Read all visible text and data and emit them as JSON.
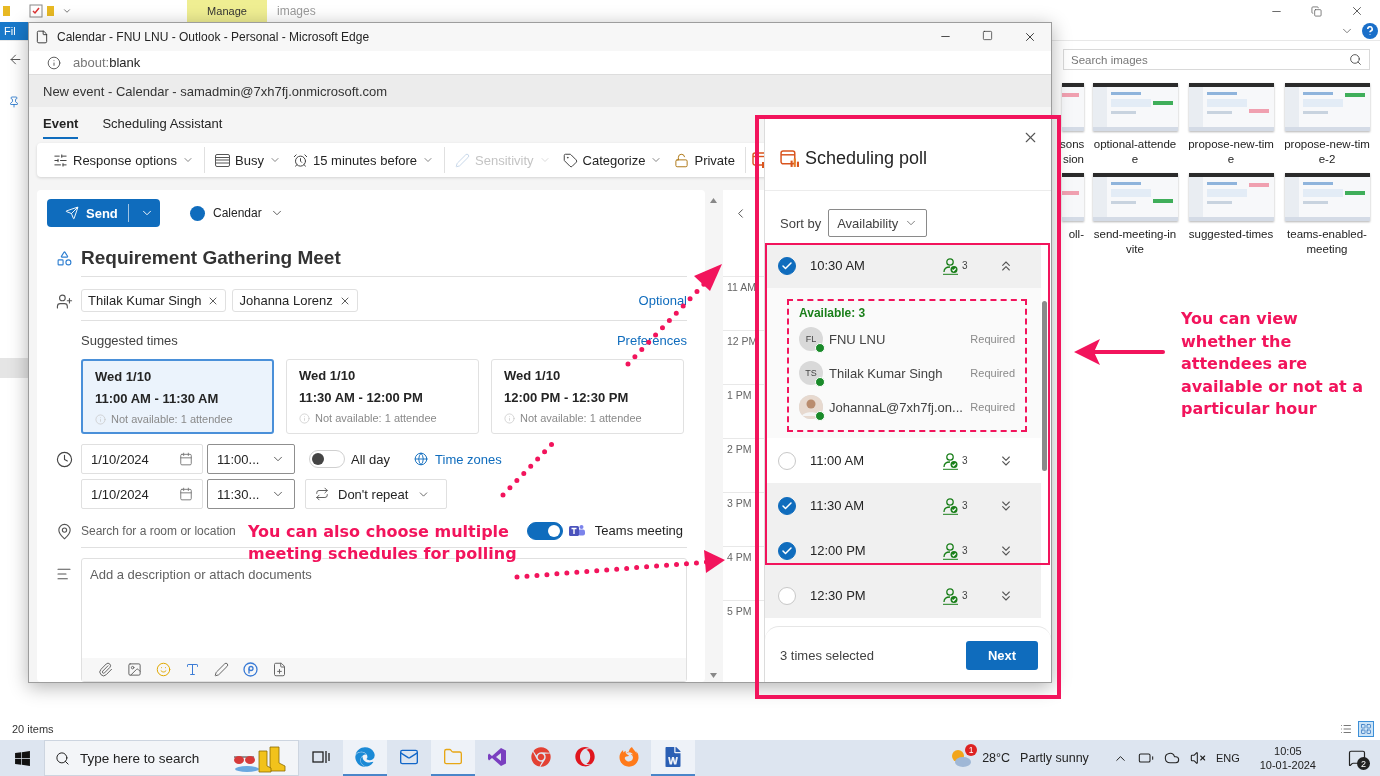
{
  "explorer": {
    "file_tab": "Fil",
    "context_tab": "Manage",
    "title": "images",
    "search": {
      "placeholder": "Search images"
    },
    "thumbnails": [
      {
        "lines": [
          "sons",
          "sion"
        ],
        "partial": true
      },
      {
        "lines": [
          "optional-attende",
          "e"
        ],
        "partial": false
      },
      {
        "lines": [
          "propose-new-tim",
          "e"
        ],
        "partial": false
      },
      {
        "lines": [
          "propose-new-tim",
          "e-2"
        ],
        "partial": false
      },
      {
        "lines": [
          "oll-"
        ],
        "partial": true
      },
      {
        "lines": [
          "send-meeting-in",
          "vite"
        ],
        "partial": false
      },
      {
        "lines": [
          "suggested-times"
        ],
        "partial": false
      },
      {
        "lines": [
          "teams-enabled-",
          "meeting"
        ],
        "partial": false
      }
    ],
    "status": "20 items"
  },
  "edge": {
    "title": "Calendar - FNU LNU - Outlook - Personal - Microsoft Edge",
    "address": {
      "scheme": "about:",
      "page": "blank"
    }
  },
  "outlook": {
    "header": "New event - Calendar - samadmin@7xh7fj.onmicrosoft.com",
    "tabs": [
      {
        "label": "Event",
        "selected": true
      },
      {
        "label": "Scheduling Assistant",
        "selected": false
      }
    ],
    "toolbar": [
      [
        {
          "label": "Response options",
          "kind": "dropdown",
          "disabled": false
        }
      ],
      [
        {
          "label": "Busy",
          "kind": "dropdown",
          "disabled": false
        },
        {
          "label": "15 minutes before",
          "kind": "dropdown",
          "disabled": false
        }
      ],
      [
        {
          "label": "Sensitivity",
          "kind": "dropdown",
          "disabled": true
        },
        {
          "label": "Categorize",
          "kind": "dropdown",
          "disabled": false
        },
        {
          "label": "Private",
          "kind": "button",
          "disabled": false
        }
      ]
    ],
    "send": "Send",
    "calendar": "Calendar",
    "subject": "Requirement Gathering Meet",
    "attendees": [
      "Thilak Kumar Singh",
      "Johanna Lorenz"
    ],
    "optional": "Optional",
    "suggested": {
      "label": "Suggested times",
      "link": "Preferences",
      "cards": [
        {
          "day": "Wed 1/10",
          "range": "11:00 AM - 11:30 AM",
          "note": "Not available: 1 attendee",
          "selected": true
        },
        {
          "day": "Wed 1/10",
          "range": "11:30 AM - 12:00 PM",
          "note": "Not available: 1 attendee",
          "selected": false
        },
        {
          "day": "Wed 1/10",
          "range": "12:00 PM - 12:30 PM",
          "note": "Not available: 1 attendee",
          "selected": false
        }
      ]
    },
    "start": {
      "date": "1/10/2024",
      "time": "11:00..."
    },
    "end": {
      "date": "1/10/2024",
      "time": "11:30..."
    },
    "all_day": {
      "label": "All day",
      "on": false
    },
    "time_zones": "Time zones",
    "repeat": "Don't repeat",
    "location": {
      "placeholder": "Search for a room or location"
    },
    "teams": {
      "label": "Teams meeting",
      "on": true
    },
    "description": {
      "placeholder": "Add a description or attach documents"
    },
    "hours": [
      "11 AM",
      "12 PM",
      "1 PM",
      "2 PM",
      "3 PM",
      "4 PM",
      "5 PM"
    ]
  },
  "poll": {
    "title": "Scheduling poll",
    "sort_label": "Sort by",
    "sort_value": "Availability",
    "times": [
      {
        "time": "10:30 AM",
        "count": "3",
        "checked": true,
        "highlighted": true,
        "expanded": true,
        "available": "Available: 3",
        "people": [
          {
            "kind": "initials",
            "initials": "FL",
            "name": "FNU LNU",
            "role": "Required"
          },
          {
            "kind": "initials",
            "initials": "TS",
            "name": "Thilak Kumar Singh",
            "role": "Required"
          },
          {
            "name": "JohannaL@7xh7fj.on...",
            "role": "Required"
          }
        ]
      },
      {
        "time": "11:00 AM",
        "count": "3",
        "checked": false,
        "highlighted": false,
        "expanded": false
      },
      {
        "time": "11:30 AM",
        "count": "3",
        "checked": true,
        "highlighted": true,
        "expanded": false
      },
      {
        "time": "12:00 PM",
        "count": "3",
        "checked": true,
        "highlighted": true,
        "expanded": false
      },
      {
        "time": "12:30 PM",
        "count": "3",
        "checked": false,
        "highlighted": true,
        "expanded": false
      }
    ],
    "status": "3 times selected",
    "next": "Next"
  },
  "annotations": [
    {
      "text": "You can view whether the attendees are available or not at a particular hour"
    },
    {
      "text": "You can also choose multiple meeting schedules for polling"
    }
  ],
  "taskbar": {
    "search": "Type here to search",
    "apps": [
      {
        "kind": "edge",
        "running": true
      },
      {
        "kind": "mail",
        "running": false
      },
      {
        "kind": "folder",
        "running": true
      },
      {
        "kind": "vs",
        "running": false
      },
      {
        "kind": "chrome",
        "running": false
      },
      {
        "kind": "opera",
        "running": false
      },
      {
        "kind": "firefox",
        "running": false
      },
      {
        "kind": "word",
        "running": true
      }
    ],
    "weather": {
      "badge": "1",
      "temp": "28°C",
      "text": "Partly sunny"
    },
    "lang": "ENG",
    "time": "10:05",
    "date": "10-01-2024",
    "notifications": "2"
  }
}
